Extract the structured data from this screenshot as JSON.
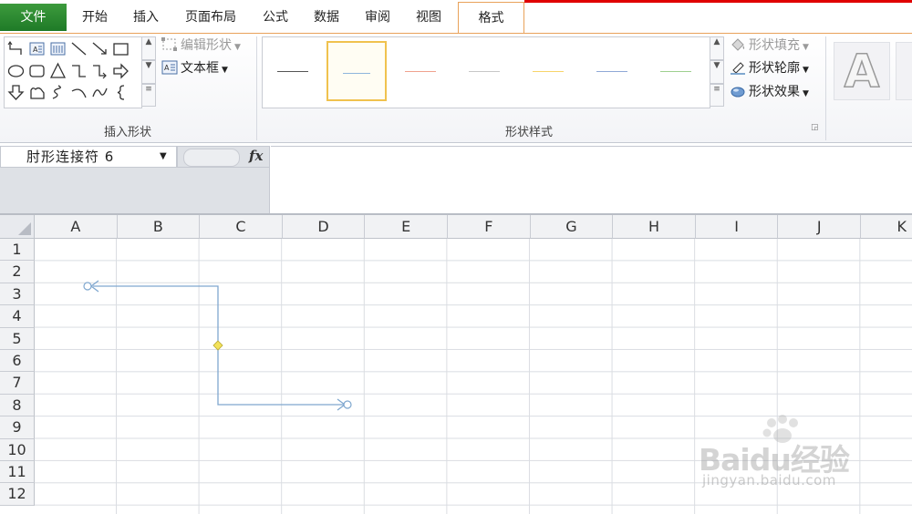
{
  "tabs": {
    "file": "文件",
    "items": [
      {
        "label": "开始"
      },
      {
        "label": "插入"
      },
      {
        "label": "页面布局"
      },
      {
        "label": "公式"
      },
      {
        "label": "数据"
      },
      {
        "label": "审阅"
      },
      {
        "label": "视图"
      },
      {
        "label": "格式"
      }
    ],
    "active": "格式"
  },
  "ribbon": {
    "insert_shapes": {
      "group_label": "插入形状",
      "edit_shape": "编辑形状",
      "text_box": "文本框"
    },
    "shape_styles": {
      "group_label": "形状样式",
      "line_colors": [
        "#555555",
        "#8fb6dc",
        "#f0a28e",
        "#c7c7c7",
        "#f7d46a",
        "#8fa8d6",
        "#9fd08f"
      ],
      "shape_fill": "形状填充",
      "shape_outline": "形状轮廓",
      "shape_effects": "形状效果"
    },
    "wordart_letter": "A"
  },
  "formula_bar": {
    "name_box": "肘形连接符  6",
    "fx": "fx",
    "formula": ""
  },
  "sheet": {
    "columns": [
      "A",
      "B",
      "C",
      "D",
      "E",
      "F",
      "G",
      "H",
      "I",
      "J",
      "K"
    ],
    "rows": [
      "1",
      "2",
      "3",
      "4",
      "5",
      "6",
      "7",
      "8",
      "9",
      "10",
      "11",
      "12"
    ]
  },
  "connector": {
    "name": "肘形连接符  6",
    "color": "#7fa7cf",
    "handle_color": "#f3e25a"
  },
  "watermark": {
    "brand": "Baidu经验",
    "url": "jingyan.baidu.com"
  }
}
